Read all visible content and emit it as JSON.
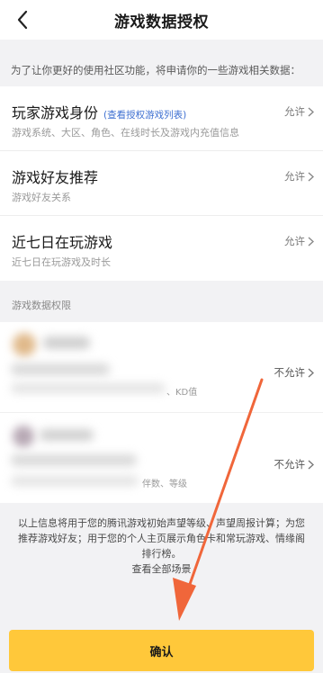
{
  "header": {
    "title": "游戏数据授权",
    "back_icon": "chevron-left-icon"
  },
  "notice": "为了让你更好的使用社区功能，将申请你的一些游戏相关数据：",
  "permissions": [
    {
      "title": "玩家游戏身份",
      "link": "(查看授权游戏列表)",
      "desc": "游戏系统、大区、角色、在线时长及游戏内充值信息",
      "status": "允许"
    },
    {
      "title": "游戏好友推荐",
      "link": "",
      "desc": "游戏好友关系",
      "status": "允许"
    },
    {
      "title": "近七日在玩游戏",
      "link": "",
      "desc": "近七日在玩游戏及时长",
      "status": "允许"
    }
  ],
  "section_label": "游戏数据权限",
  "game_items": [
    {
      "desc_tail": "、KD值",
      "status": "不允许"
    },
    {
      "desc_tail": "伴数、等级",
      "status": "不允许"
    }
  ],
  "footer": {
    "text": "以上信息将用于您的腾讯游戏初始声望等级、声望周报计算；为您推荐游戏好友；用于您的个人主页展示角色卡和常玩游戏、情缘阁排行榜。",
    "view_all": "查看全部场景"
  },
  "confirm_button": "确认",
  "colors": {
    "accent": "#ffc83a",
    "link": "#3d6fd1",
    "arrow": "#f0663a"
  }
}
